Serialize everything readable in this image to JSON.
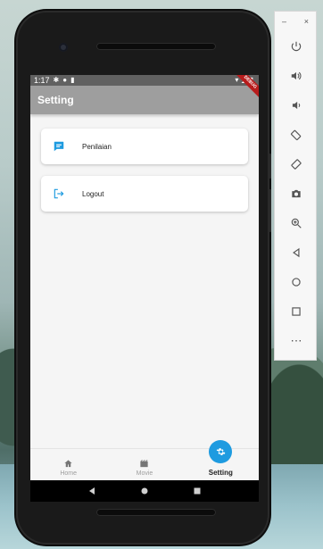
{
  "status_bar": {
    "time": "1:17",
    "debug_banner": "DEBUG"
  },
  "app_bar": {
    "title": "Setting"
  },
  "menu": {
    "items": [
      {
        "label": "Penilaian",
        "icon": "rate-review-icon"
      },
      {
        "label": "Logout",
        "icon": "logout-icon"
      }
    ]
  },
  "bottom_nav": {
    "items": [
      {
        "label": "Home",
        "icon": "home-icon",
        "active": false
      },
      {
        "label": "Movie",
        "icon": "movie-icon",
        "active": false
      },
      {
        "label": "Setting",
        "icon": "settings-icon",
        "active": true
      }
    ]
  },
  "emulator_toolbar": {
    "minimize": "–",
    "close": "×",
    "more": "⋯"
  },
  "colors": {
    "accent": "#1e9be0",
    "app_bar": "#9e9e9e",
    "status_bar": "#616161",
    "debug_banner": "#b71c1c"
  }
}
